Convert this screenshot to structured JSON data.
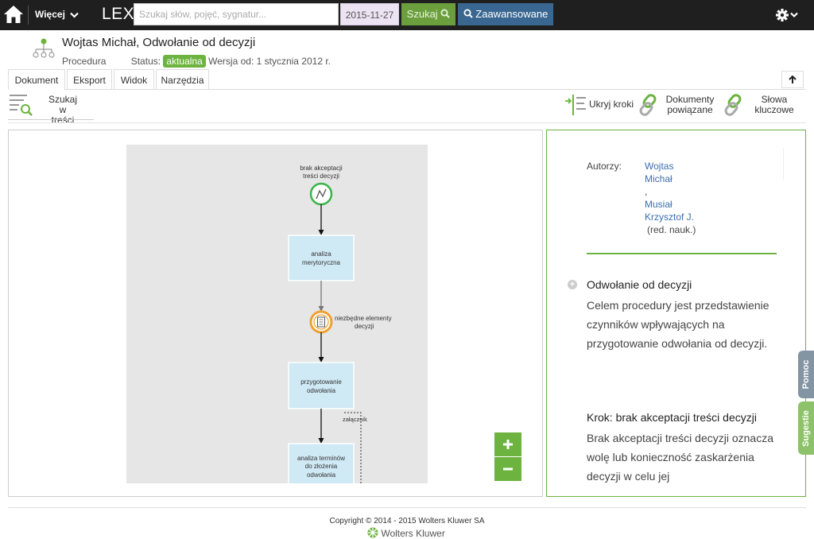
{
  "topbar": {
    "more_label": "Więcej",
    "app_name": "LEX",
    "search_placeholder": "Szukaj słów, pojęć, sygnatur...",
    "date": "2015-11-27",
    "search_button": "Szukaj",
    "advanced_button": "Zaawansowane"
  },
  "document": {
    "title": "Wojtas Michał, Odwołanie od decyzji",
    "type": "Procedura",
    "status_label": "Status:",
    "status_value": "aktualna",
    "version": "Wersja od: 1 stycznia 2012 r."
  },
  "tabs": [
    {
      "label": "Dokument"
    },
    {
      "label": "Eksport"
    },
    {
      "label": "Widok"
    },
    {
      "label": "Narzędzia"
    }
  ],
  "toolbar": {
    "search_in_content_line1": "Szukaj w",
    "search_in_content_line2": "treści",
    "hide_steps": "Ukryj kroki",
    "related_docs_line1": "Dokumenty",
    "related_docs_line2": "powiązane",
    "keywords_line1": "Słowa",
    "keywords_line2": "kluczowe"
  },
  "diagram": {
    "start_event_line1": "brak akceptacji",
    "start_event_line2": "treści decyzji",
    "task1_line1": "analiza",
    "task1_line2": "merytoryczna",
    "intermediate_line1": "niezbędne elementy",
    "intermediate_line2": "decyzji",
    "task2_line1": "przygotowanie",
    "task2_line2": "odwołania",
    "attachment": "załącznik",
    "task3_line1": "analiza terminów",
    "task3_line2": "do złożenia",
    "task3_line3": "odwołania"
  },
  "right_panel": {
    "authors_label": "Autorzy:",
    "author1_line1": "Wojtas",
    "author1_line2": "Michał",
    "separator": ",",
    "author2_line1": "Musiał",
    "author2_line2": "Krzysztof J.",
    "editor_note": "(red. nauk.)",
    "section_title": "Odwołanie od decyzji",
    "section_body": "Celem procedury jest przedstawienie czynników wpływających na przygotowanie odwołania od decyzji.",
    "step_title": "Krok: brak akceptacji treści decyzji",
    "step_body": "Brak akceptacji treści decyzji oznacza wolę lub konieczność zaskarżenia decyzji w celu jej"
  },
  "side_tabs": {
    "help": "Pomoc",
    "suggestions": "Sugestie"
  },
  "footer": {
    "copyright": "Copyright © 2014 - 2015 Wolters Kluwer SA",
    "brand": "Wolters Kluwer"
  },
  "colors": {
    "accent_green": "#6db33f",
    "nav_blue": "#3a6791",
    "topbar_bg": "#1f1f1f"
  }
}
